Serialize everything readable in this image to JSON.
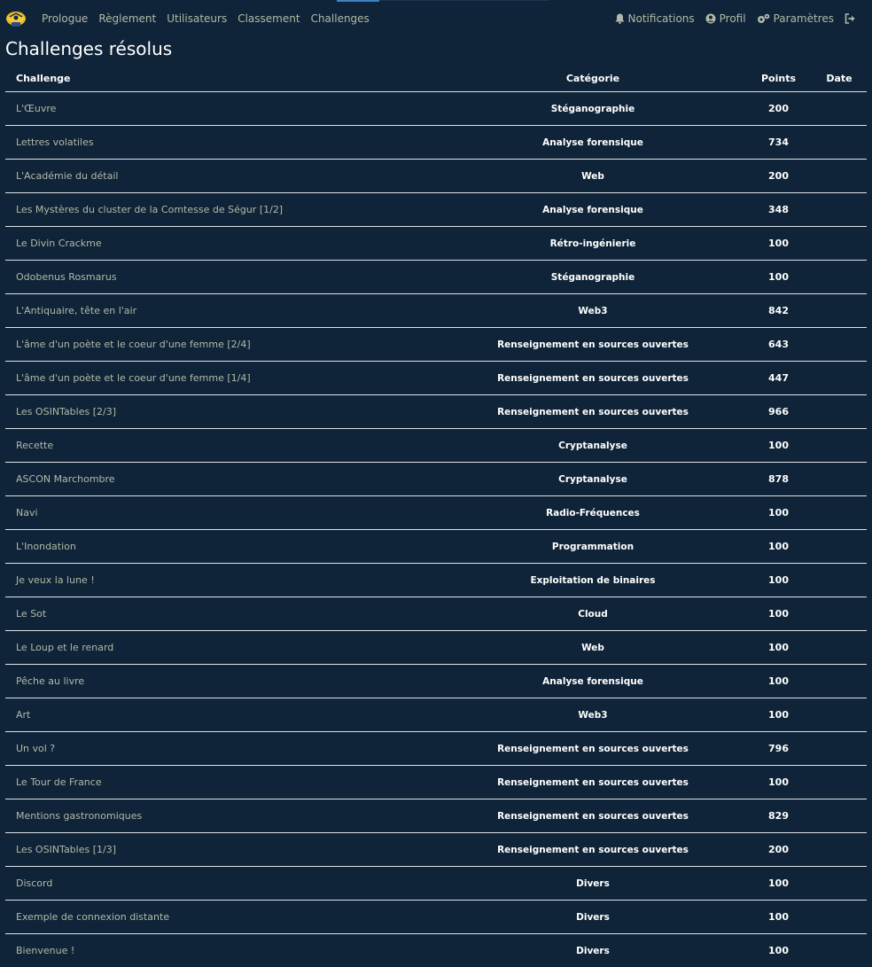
{
  "nav": {
    "left": [
      "Prologue",
      "Règlement",
      "Utilisateurs",
      "Classement",
      "Challenges"
    ],
    "notifications": "Notifications",
    "profile": "Profil",
    "settings": "Paramètres"
  },
  "page_title": "Challenges résolus",
  "table": {
    "headers": [
      "Challenge",
      "Catégorie",
      "Points",
      "Date"
    ],
    "rows": [
      {
        "name": "L'Œuvre",
        "category": "Stéganographie",
        "points": "200"
      },
      {
        "name": "Lettres volatiles",
        "category": "Analyse forensique",
        "points": "734"
      },
      {
        "name": "L'Académie du détail",
        "category": "Web",
        "points": "200"
      },
      {
        "name": "Les Mystères du cluster de la Comtesse de Ségur [1/2]",
        "category": "Analyse forensique",
        "points": "348"
      },
      {
        "name": "Le Divin Crackme",
        "category": "Rétro-ingénierie",
        "points": "100"
      },
      {
        "name": "Odobenus Rosmarus",
        "category": "Stéganographie",
        "points": "100"
      },
      {
        "name": "L'Antiquaire, tête en l'air",
        "category": "Web3",
        "points": "842"
      },
      {
        "name": "L'âme d'un poète et le coeur d'une femme [2/4]",
        "category": "Renseignement en sources ouvertes",
        "points": "643"
      },
      {
        "name": "L'âme d'un poète et le coeur d'une femme [1/4]",
        "category": "Renseignement en sources ouvertes",
        "points": "447"
      },
      {
        "name": "Les OSINTables [2/3]",
        "category": "Renseignement en sources ouvertes",
        "points": "966"
      },
      {
        "name": "Recette",
        "category": "Cryptanalyse",
        "points": "100"
      },
      {
        "name": "ASCON Marchombre",
        "category": "Cryptanalyse",
        "points": "878"
      },
      {
        "name": "Navi",
        "category": "Radio-Fréquences",
        "points": "100"
      },
      {
        "name": "L'Inondation",
        "category": "Programmation",
        "points": "100"
      },
      {
        "name": "Je veux la lune !",
        "category": "Exploitation de binaires",
        "points": "100"
      },
      {
        "name": "Le Sot",
        "category": "Cloud",
        "points": "100"
      },
      {
        "name": "Le Loup et le renard",
        "category": "Web",
        "points": "100"
      },
      {
        "name": "Pêche au livre",
        "category": "Analyse forensique",
        "points": "100"
      },
      {
        "name": "Art",
        "category": "Web3",
        "points": "100"
      },
      {
        "name": "Un vol ?",
        "category": "Renseignement en sources ouvertes",
        "points": "796"
      },
      {
        "name": "Le Tour de France",
        "category": "Renseignement en sources ouvertes",
        "points": "100"
      },
      {
        "name": "Mentions gastronomiques",
        "category": "Renseignement en sources ouvertes",
        "points": "829"
      },
      {
        "name": "Les OSINTables [1/3]",
        "category": "Renseignement en sources ouvertes",
        "points": "200"
      },
      {
        "name": "Discord",
        "category": "Divers",
        "points": "100"
      },
      {
        "name": "Exemple de connexion distante",
        "category": "Divers",
        "points": "100"
      },
      {
        "name": "Bienvenue !",
        "category": "Divers",
        "points": "100"
      }
    ]
  }
}
